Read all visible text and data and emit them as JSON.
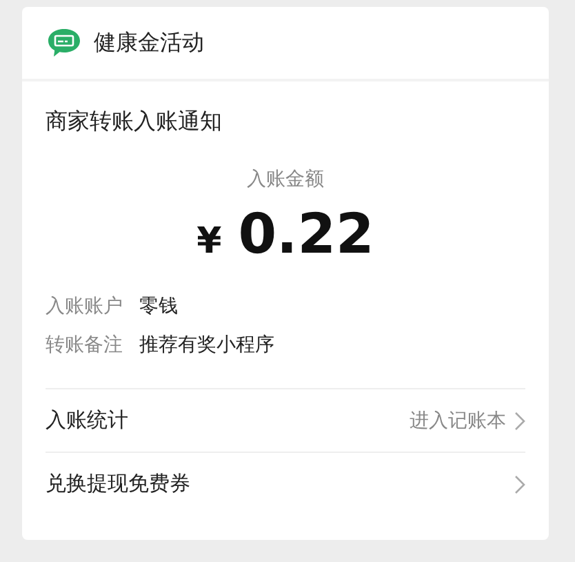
{
  "header": {
    "title": "健康金活动"
  },
  "notice": {
    "title": "商家转账入账通知",
    "amount_label": "入账金额",
    "currency": "¥",
    "amount": "0.22"
  },
  "details": [
    {
      "label": "入账账户",
      "value": "零钱"
    },
    {
      "label": "转账备注",
      "value": "推荐有奖小程序"
    }
  ],
  "links": [
    {
      "label": "入账统计",
      "action": "进入记账本"
    },
    {
      "label": "兑换提现免费券"
    }
  ]
}
